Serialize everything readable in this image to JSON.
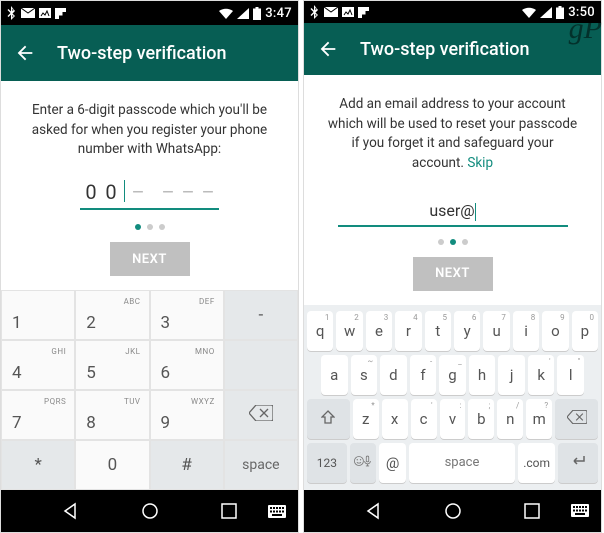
{
  "left": {
    "status": {
      "time": "3:47"
    },
    "toolbar": {
      "title": "Two-step verification"
    },
    "instruction": "Enter a 6-digit passcode which you'll be asked for when you register your phone number with WhatsApp:",
    "passcode": {
      "entered": [
        "0",
        "0"
      ],
      "placeholder": "–"
    },
    "next_label": "NEXT",
    "pager_active": 0,
    "numkeys": {
      "k1": "1",
      "k2": "2",
      "k3": "3",
      "k4": "4",
      "k5": "5",
      "k6": "6",
      "k7": "7",
      "k8": "8",
      "k9": "9",
      "k0": "0",
      "a2": "ABC",
      "a3": "DEF",
      "a4": "GHI",
      "a5": "JKL",
      "a6": "MNO",
      "a7": "PQRS",
      "a8": "TUV",
      "a9": "WXYZ",
      "dash": "-",
      "star": "*",
      "hash": "#",
      "space": "space"
    }
  },
  "right": {
    "status": {
      "time": "3:50"
    },
    "toolbar": {
      "title": "Two-step verification"
    },
    "instruction_pre": "Add an email address to your account which will be used to reset your passcode if you forget it and safeguard your account. ",
    "skip_label": "Skip",
    "email_value": "user@",
    "next_label": "NEXT",
    "pager_active": 1,
    "qwerty": {
      "r1": [
        [
          "q",
          "1"
        ],
        [
          "w",
          "2"
        ],
        [
          "e",
          "3"
        ],
        [
          "r",
          "4"
        ],
        [
          "t",
          "5"
        ],
        [
          "y",
          "6"
        ],
        [
          "u",
          "7"
        ],
        [
          "i",
          "8"
        ],
        [
          "o",
          "9"
        ],
        [
          "p",
          "0"
        ]
      ],
      "r2": [
        [
          "a",
          ""
        ],
        [
          "s",
          "~"
        ],
        [
          "d",
          ""
        ],
        [
          "f",
          "-"
        ],
        [
          "g",
          "_"
        ],
        [
          "h",
          ""
        ],
        [
          "j",
          ""
        ],
        [
          "k",
          "'"
        ],
        [
          "l",
          "\""
        ]
      ],
      "r3": [
        [
          "z",
          "*"
        ],
        [
          "x",
          ""
        ],
        [
          "c",
          "'"
        ],
        [
          "v",
          ":"
        ],
        [
          "b",
          ";"
        ],
        [
          "n",
          "/"
        ],
        [
          "m",
          "?"
        ]
      ],
      "k123": "123",
      "at": "@",
      "space": "space",
      "com": ".com"
    }
  },
  "watermark": "gP"
}
